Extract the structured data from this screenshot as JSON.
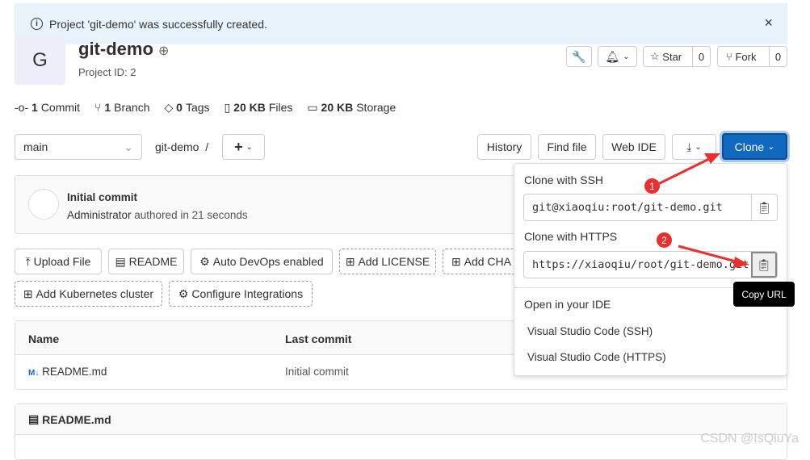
{
  "alert": {
    "text": "Project 'git-demo' was successfully created.",
    "close": "×"
  },
  "project": {
    "avatar_letter": "G",
    "name": "git-demo",
    "id_text": "Project ID: 2"
  },
  "header_actions": {
    "star": "Star",
    "star_count": "0",
    "fork": "Fork",
    "fork_count": "0"
  },
  "stats": [
    {
      "num": "1",
      "label": "Commit"
    },
    {
      "num": "1",
      "label": "Branch"
    },
    {
      "num": "0",
      "label": "Tags"
    },
    {
      "num": "20 KB",
      "label": "Files"
    },
    {
      "num": "20 KB",
      "label": "Storage"
    }
  ],
  "toolbar": {
    "branch": "main",
    "path": "git-demo",
    "sep": "/",
    "history": "History",
    "find_file": "Find file",
    "web_ide": "Web IDE",
    "clone": "Clone"
  },
  "commit": {
    "title": "Initial commit",
    "author": "Administrator",
    "meta": " authored in 21 seconds"
  },
  "quick_actions": [
    "Upload File",
    "README",
    "Auto DevOps enabled",
    "Add LICENSE",
    "Add CHA",
    "Add Kubernetes cluster",
    "Configure Integrations"
  ],
  "table": {
    "headers": [
      "Name",
      "Last commit"
    ],
    "rows": [
      {
        "name": "README.md",
        "commit": "Initial commit"
      }
    ]
  },
  "readme": {
    "title": "README.md"
  },
  "clone_dropdown": {
    "ssh_label": "Clone with SSH",
    "ssh_url": "git@xiaoqiu:root/git-demo.git",
    "https_label": "Clone with HTTPS",
    "https_url": "https://xiaoqiu/root/git-demo.git",
    "ide_label": "Open in your IDE",
    "ide_items": [
      "Visual Studio Code (SSH)",
      "Visual Studio Code (HTTPS)"
    ]
  },
  "tooltip": "Copy URL",
  "annotations": [
    "1",
    "2"
  ],
  "watermark": "CSDN @IsQiuYa",
  "colors": {
    "primary": "#1068bf",
    "alert_bg": "#e9f3fc",
    "annotation": "#e8312e"
  }
}
